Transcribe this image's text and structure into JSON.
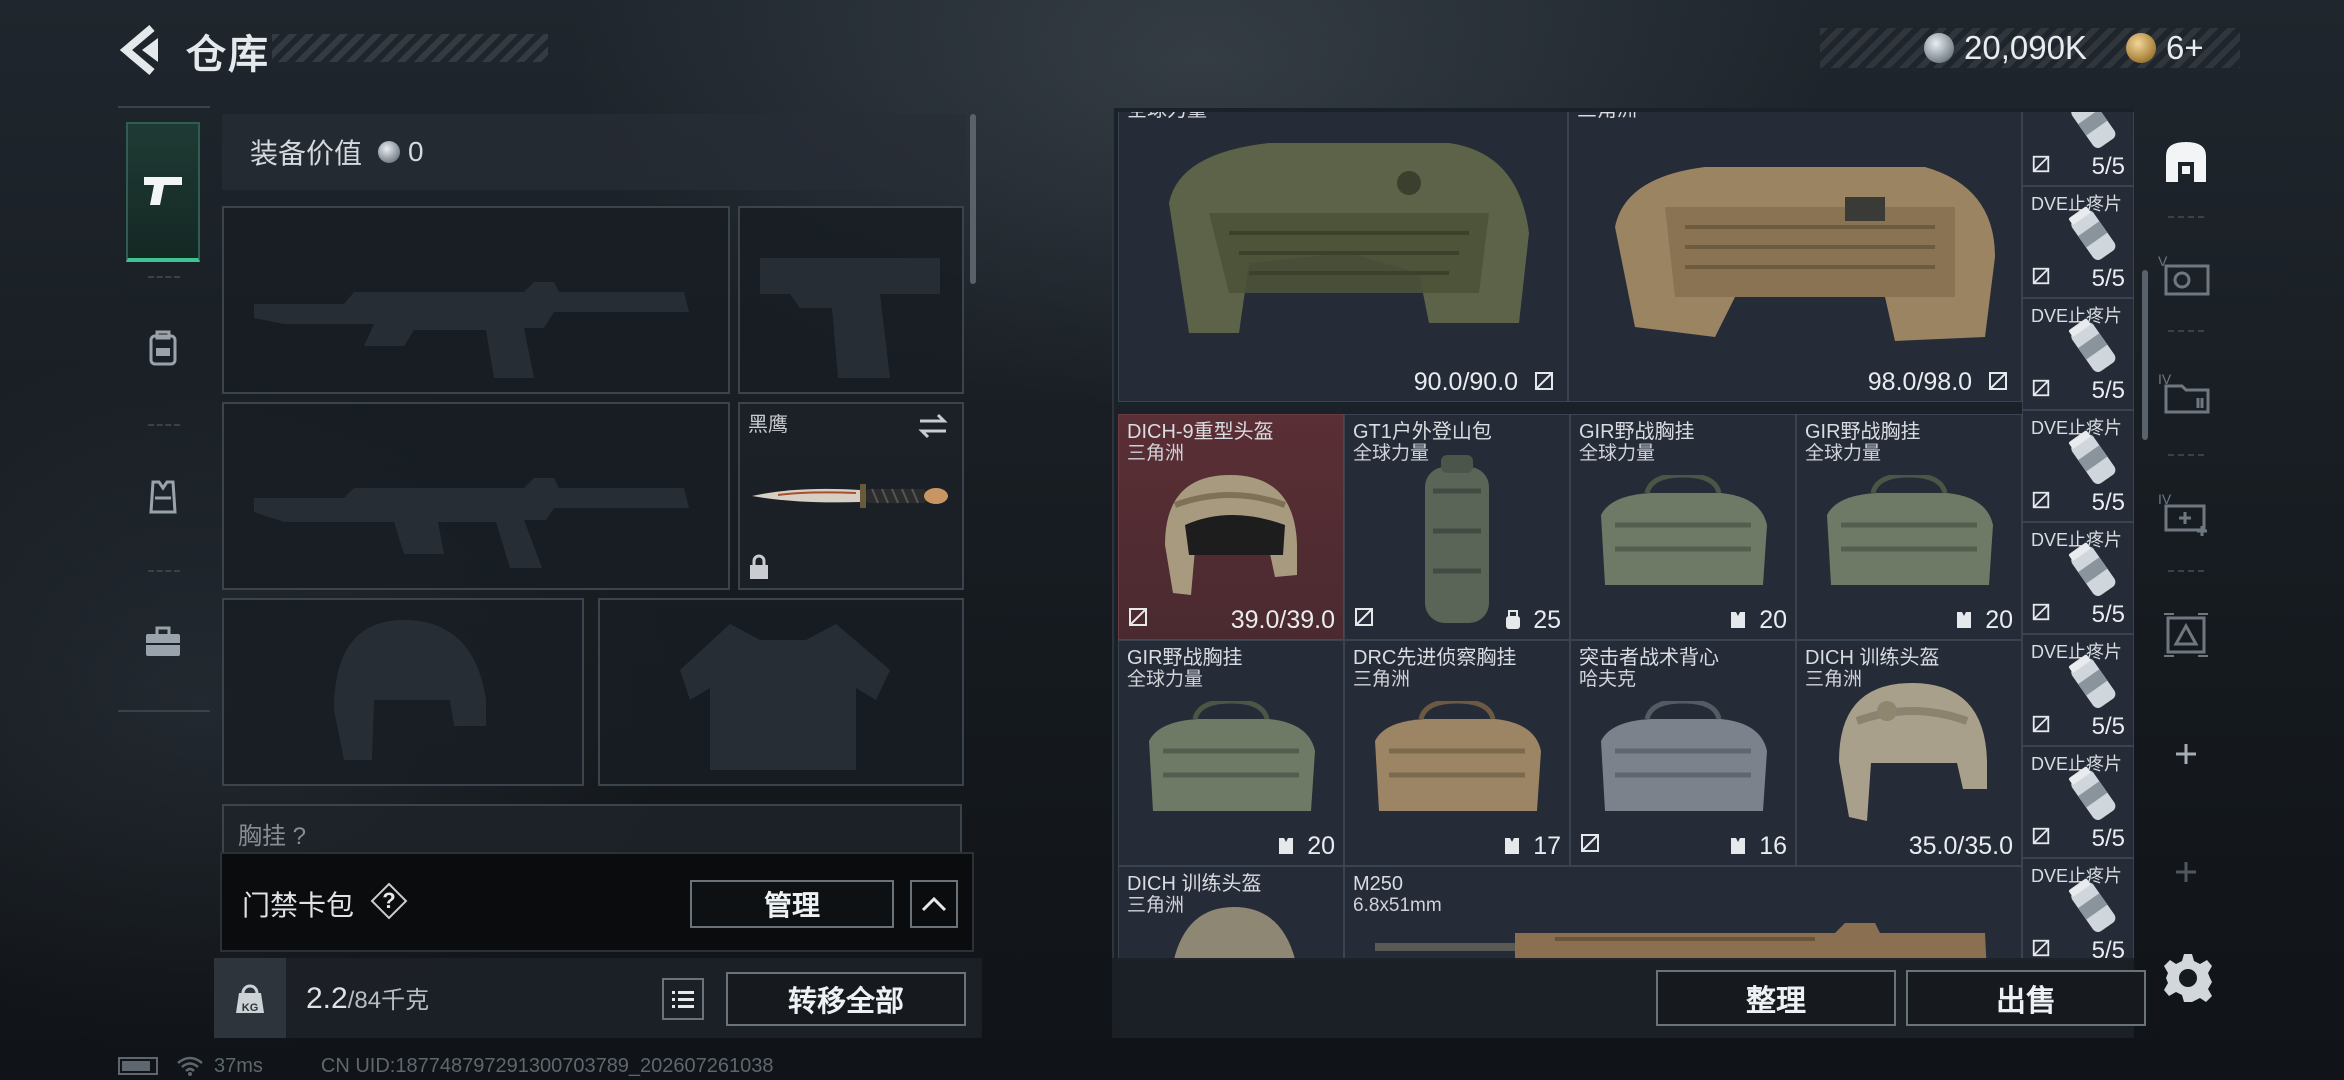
{
  "header": {
    "title": "仓库",
    "currency": [
      {
        "icon": "silver-coin-icon",
        "amount": "20,090K"
      },
      {
        "icon": "gold-coin-icon",
        "amount": "6+"
      }
    ]
  },
  "left_tabs": [
    {
      "icon": "pistol-icon",
      "active": true
    },
    {
      "icon": "backpack-icon",
      "active": false
    },
    {
      "icon": "vest-icon",
      "active": false
    },
    {
      "icon": "briefcase-icon",
      "active": false
    }
  ],
  "loadout": {
    "value_label": "装备价值",
    "value_amount": "0",
    "melee_name": "黑鹰",
    "cut_off_slot_label": "胸挂 ?"
  },
  "access_card": {
    "label": "门禁卡包",
    "help": "?",
    "manage_label": "管理"
  },
  "weight": {
    "icon_text": "KG",
    "current": "2.2",
    "capacity": "/84千克",
    "transfer_label": "转移全部"
  },
  "inventory": {
    "big_items": [
      {
        "name": "全球力量",
        "value": "90.0/90.0"
      },
      {
        "name": "三角洲",
        "value": "98.0/98.0"
      }
    ],
    "row2": [
      {
        "name": "DICH-9重型头盔",
        "sub": "三角洲",
        "value": "39.0/39.0",
        "highlight": true
      },
      {
        "name": "GT1户外登山包",
        "sub": "全球力量",
        "value": "25"
      },
      {
        "name": "GIR野战胸挂",
        "sub": "全球力量",
        "value": "20"
      },
      {
        "name": "GIR野战胸挂",
        "sub": "全球力量",
        "value": "20"
      }
    ],
    "row3": [
      {
        "name": "GIR野战胸挂",
        "sub": "全球力量",
        "value": "20"
      },
      {
        "name": "DRC先进侦察胸挂",
        "sub": "三角洲",
        "value": "17"
      },
      {
        "name": "突击者战术背心",
        "sub": "哈夫克",
        "value": "16"
      },
      {
        "name": "DICH 训练头盔",
        "sub": "三角洲",
        "value": "35.0/35.0"
      }
    ],
    "row4": [
      {
        "name": "DICH 训练头盔",
        "sub": "三角洲"
      },
      {
        "name": "M250",
        "sub": "6.8x51mm"
      }
    ],
    "med_column": [
      {
        "name": "",
        "value": "5/5"
      },
      {
        "name": "DVE止疼片",
        "value": "5/5"
      },
      {
        "name": "DVE止疼片",
        "value": "5/5"
      },
      {
        "name": "DVE止疼片",
        "value": "5/5"
      },
      {
        "name": "DVE止疼片",
        "value": "5/5"
      },
      {
        "name": "DVE止疼片",
        "value": "5/5"
      },
      {
        "name": "DVE止疼片",
        "value": "5/5"
      },
      {
        "name": "DVE止疼片",
        "value": "5/5"
      }
    ]
  },
  "right_rail": [
    {
      "icon": "safebox-icon",
      "label": ""
    },
    {
      "icon": "camera-case-icon",
      "label": "V"
    },
    {
      "icon": "folder-case-icon",
      "label": "IV"
    },
    {
      "icon": "medkit-case-icon",
      "label": "IV"
    },
    {
      "icon": "ammo-case-icon",
      "label": ""
    },
    {
      "icon": "add-icon",
      "label": "+"
    },
    {
      "icon": "add-icon",
      "label": "+"
    }
  ],
  "actions": {
    "sort_label": "整理",
    "sell_label": "出售"
  },
  "status_bar": {
    "ping": "37ms",
    "uid": "CN UID:187748797291300703789_202607261038"
  }
}
